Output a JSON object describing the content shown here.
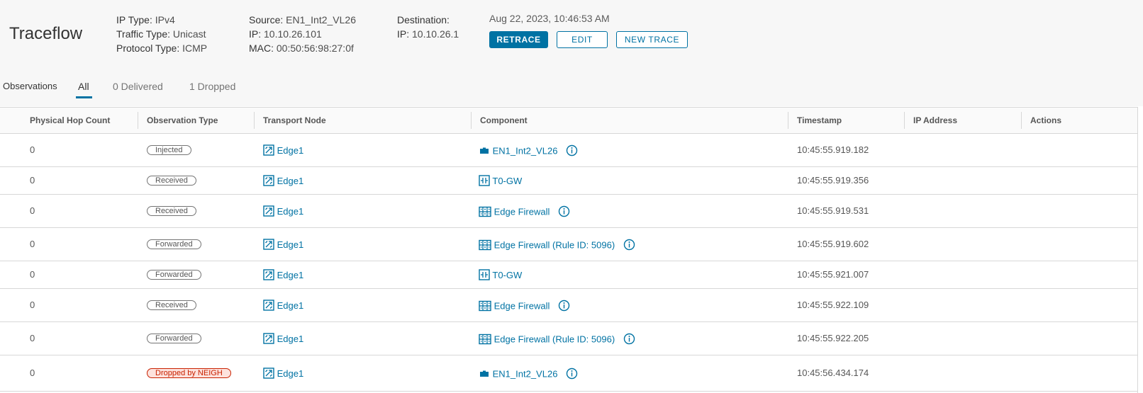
{
  "header": {
    "title": "Traceflow",
    "ip_type_label": "IP Type:",
    "ip_type_value": "IPv4",
    "traffic_type_label": "Traffic Type:",
    "traffic_type_value": "Unicast",
    "protocol_type_label": "Protocol Type:",
    "protocol_type_value": "ICMP",
    "source_label": "Source:",
    "source_value": "EN1_Int2_VL26",
    "source_ip_label": "IP:",
    "source_ip_value": "10.10.26.101",
    "source_mac_label": "MAC:",
    "source_mac_value": "00:50:56:98:27:0f",
    "destination_label": "Destination:",
    "destination_ip_label": "IP:",
    "destination_ip_value": "10.10.26.1",
    "datetime": "Aug 22, 2023, 10:46:53 AM",
    "retrace_label": "RETRACE",
    "edit_label": "EDIT",
    "new_trace_label": "NEW TRACE"
  },
  "tabs": {
    "label": "Observations",
    "items": [
      "All",
      "0 Delivered",
      "1 Dropped"
    ],
    "active": "All"
  },
  "table": {
    "columns": [
      "Physical Hop Count",
      "Observation Type",
      "Transport Node",
      "Component",
      "Timestamp",
      "IP Address",
      "Actions"
    ],
    "rows": [
      {
        "hop": "0",
        "type": "Injected",
        "node": "Edge1",
        "component": "EN1_Int2_VL26",
        "component_icon": "vnic-icon",
        "info": true,
        "timestamp": "10:45:55.919.182",
        "ip": "",
        "dropped": false
      },
      {
        "hop": "0",
        "type": "Received",
        "node": "Edge1",
        "component": "T0-GW",
        "component_icon": "router-icon",
        "info": false,
        "timestamp": "10:45:55.919.356",
        "ip": "",
        "dropped": false
      },
      {
        "hop": "0",
        "type": "Received",
        "node": "Edge1",
        "component": "Edge Firewall",
        "component_icon": "firewall-icon",
        "info": true,
        "timestamp": "10:45:55.919.531",
        "ip": "",
        "dropped": false
      },
      {
        "hop": "0",
        "type": "Forwarded",
        "node": "Edge1",
        "component": "Edge Firewall (Rule ID: 5096)",
        "component_icon": "firewall-icon",
        "info": true,
        "timestamp": "10:45:55.919.602",
        "ip": "",
        "dropped": false
      },
      {
        "hop": "0",
        "type": "Forwarded",
        "node": "Edge1",
        "component": "T0-GW",
        "component_icon": "router-icon",
        "info": false,
        "timestamp": "10:45:55.921.007",
        "ip": "",
        "dropped": false
      },
      {
        "hop": "0",
        "type": "Received",
        "node": "Edge1",
        "component": "Edge Firewall",
        "component_icon": "firewall-icon",
        "info": true,
        "timestamp": "10:45:55.922.109",
        "ip": "",
        "dropped": false
      },
      {
        "hop": "0",
        "type": "Forwarded",
        "node": "Edge1",
        "component": "Edge Firewall (Rule ID: 5096)",
        "component_icon": "firewall-icon",
        "info": true,
        "timestamp": "10:45:55.922.205",
        "ip": "",
        "dropped": false
      },
      {
        "hop": "0",
        "type": "Dropped by NEIGH",
        "node": "Edge1",
        "component": "EN1_Int2_VL26",
        "component_icon": "vnic-icon",
        "info": true,
        "timestamp": "10:45:56.434.174",
        "ip": "",
        "dropped": true
      }
    ]
  },
  "colors": {
    "accent": "#0072a3",
    "dropped_border": "#c92100",
    "dropped_bg": "#fde2dd"
  }
}
